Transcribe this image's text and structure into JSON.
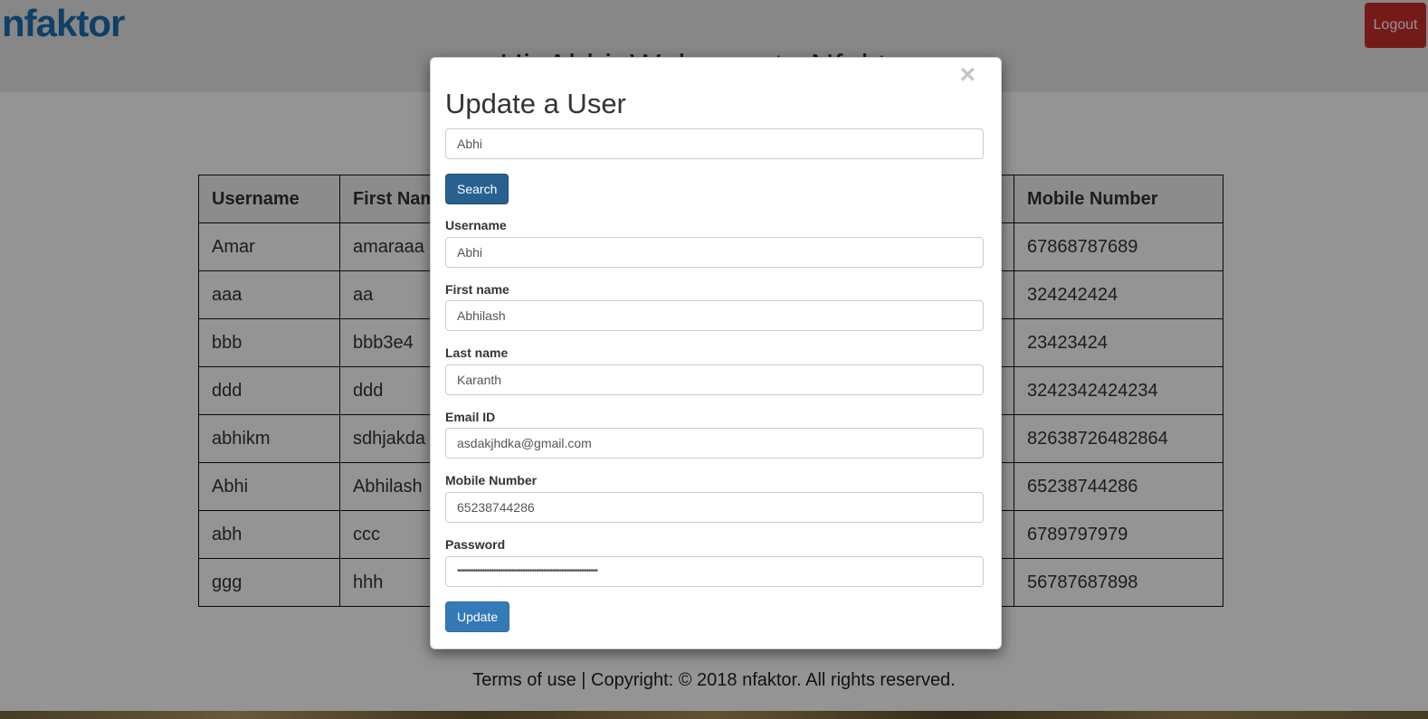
{
  "header": {
    "logo": "nfaktor",
    "welcome": "Hi, Abhi, Welcome to Nfaktor",
    "logout_label": "Logout"
  },
  "users_table": {
    "columns": [
      "Username",
      "First Name",
      "Mobile Number"
    ],
    "rows": [
      {
        "username": "Amar",
        "first_name": "amaraaa",
        "mobile": "67868787689"
      },
      {
        "username": "aaa",
        "first_name": "aa",
        "mobile": "324242424"
      },
      {
        "username": "bbb",
        "first_name": "bbb3e4",
        "mobile": "23423424"
      },
      {
        "username": "ddd",
        "first_name": "ddd",
        "mobile": "3242342424234"
      },
      {
        "username": "abhikm",
        "first_name": "sdhjakda",
        "mobile": "82638726482864"
      },
      {
        "username": "Abhi",
        "first_name": "Abhilash",
        "mobile": "65238744286"
      },
      {
        "username": "abh",
        "first_name": "ccc",
        "mobile": "6789797979"
      },
      {
        "username": "ggg",
        "first_name": "hhh",
        "mobile": "56787687898"
      }
    ]
  },
  "footer": {
    "text": "Terms of use | Copyright: © 2018 nfaktor. All rights reserved."
  },
  "modal": {
    "close_icon": "close-icon",
    "title": "Update a User",
    "search_value": "Abhi",
    "search_label": "Search",
    "username_label": "Username",
    "username_value": "Abhi",
    "first_name_label": "First name",
    "first_name_value": "Abhilash",
    "last_name_label": "Last name",
    "last_name_value": "Karanth",
    "email_label": "Email ID",
    "email_value": "asdakjhdka@gmail.com",
    "mobile_label": "Mobile Number",
    "mobile_value": "65238744286",
    "password_label": "Password",
    "password_value": "••••••••••••••••••••••••••••••••••••••••••••••••••••••••••••••",
    "update_label": "Update"
  }
}
